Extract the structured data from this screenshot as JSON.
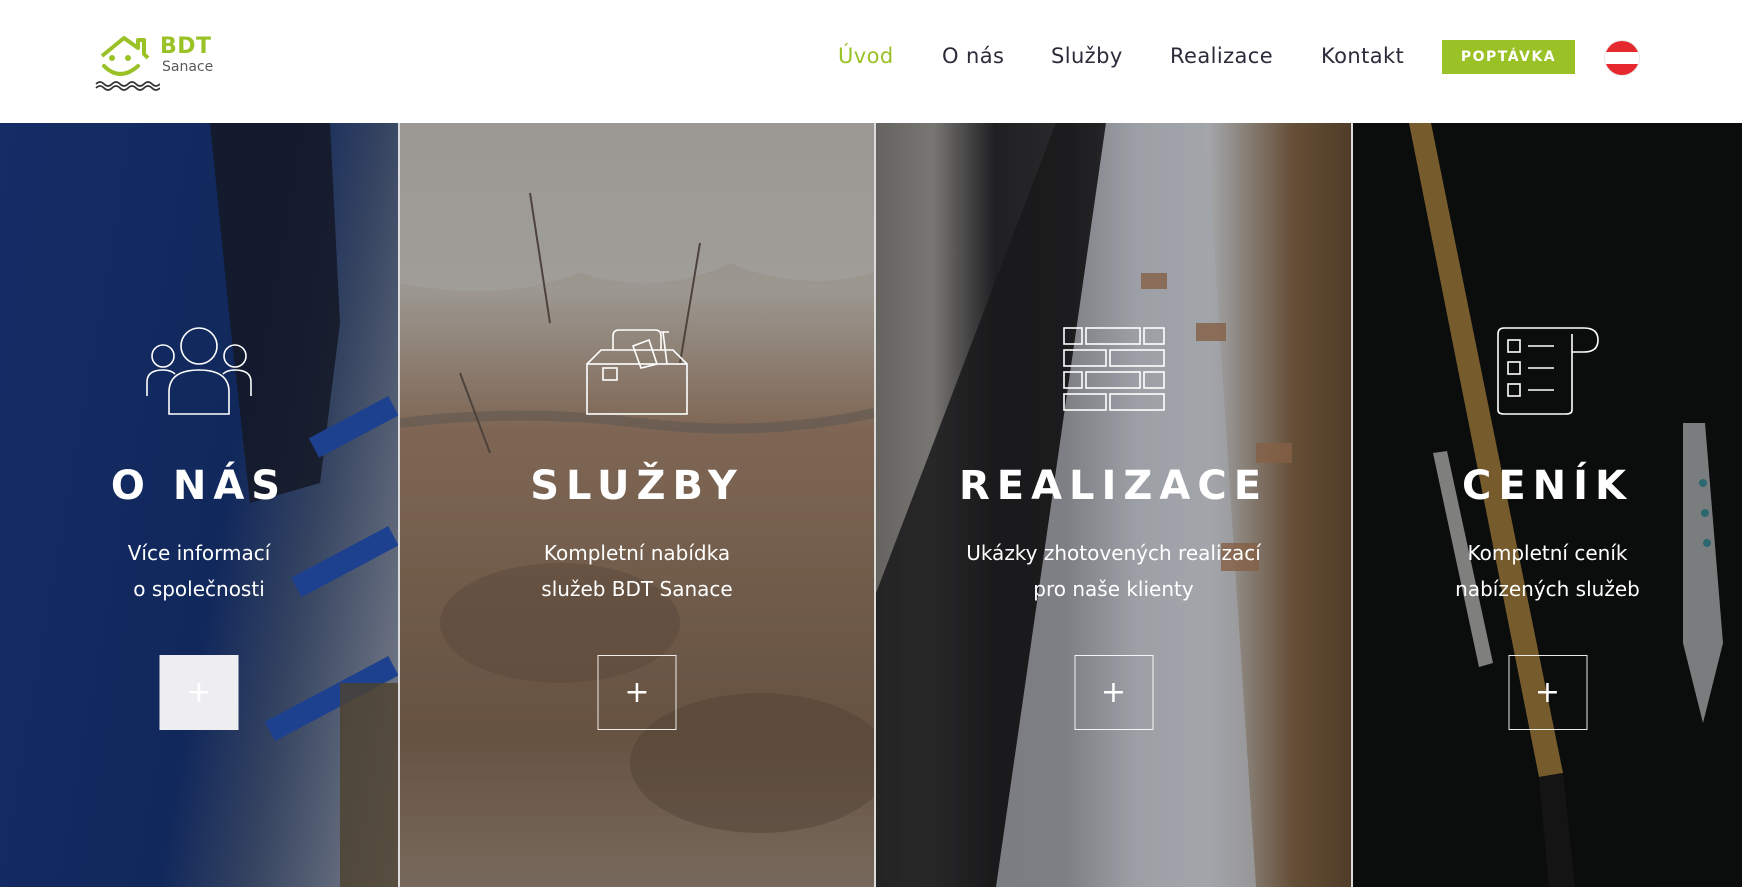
{
  "logo": {
    "main": "BDT",
    "sub": "Sanace"
  },
  "nav": [
    {
      "label": "Úvod",
      "active": true
    },
    {
      "label": "O nás"
    },
    {
      "label": "Služby"
    },
    {
      "label": "Realizace"
    },
    {
      "label": "Kontakt"
    }
  ],
  "cta": {
    "label": "POPTÁVKA"
  },
  "language_flag": {
    "icon": "austria-flag-icon",
    "colors": [
      "#e6292f",
      "#ffffff",
      "#e6292f"
    ]
  },
  "colors": {
    "accent": "#9ac227",
    "nav_text": "#2b2b3a"
  },
  "panels": [
    {
      "title": "O NÁS",
      "line1": "Více informací",
      "line2": "o společnosti",
      "icon": "people-group-icon",
      "plus": "+"
    },
    {
      "title": "SLUŽBY",
      "line1": "Kompletní nabídka",
      "line2": "služeb BDT Sanace",
      "icon": "toolbox-icon",
      "plus": "+"
    },
    {
      "title": "REALIZACE",
      "line1": "Ukázky zhotovených realizací",
      "line2": "pro naše klienty",
      "icon": "brick-wall-icon",
      "plus": "+"
    },
    {
      "title": "CENÍK",
      "line1": "Kompletní ceník",
      "line2": "nabízených služeb",
      "icon": "price-list-scroll-icon",
      "plus": "+"
    }
  ]
}
